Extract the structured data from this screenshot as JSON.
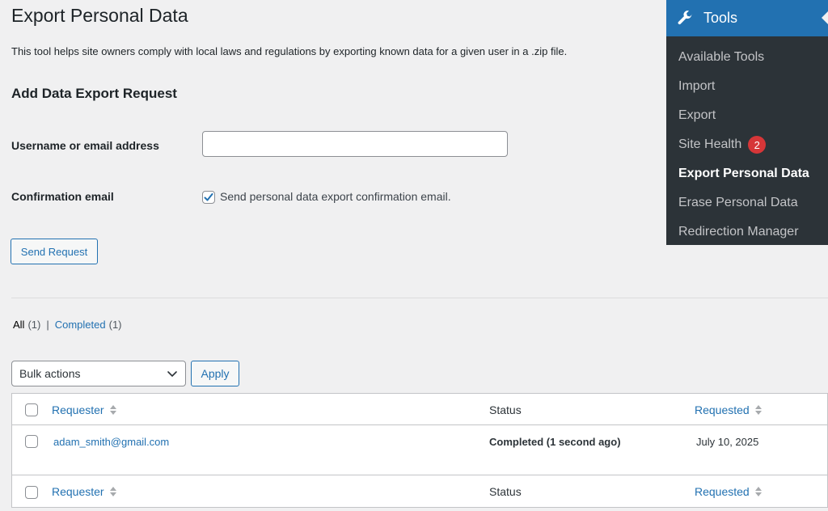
{
  "page": {
    "title": "Export Personal Data",
    "intro": "This tool helps site owners comply with local laws and regulations by exporting known data for a given user in a .zip file."
  },
  "form": {
    "section_title": "Add Data Export Request",
    "username_label": "Username or email address",
    "username_value": "",
    "confirm_label": "Confirmation email",
    "confirm_checkbox_text": "Send personal data export confirmation email.",
    "confirm_checked": true,
    "send_button": "Send Request"
  },
  "filters": {
    "all_label": "All",
    "all_count": "(1)",
    "separator": "|",
    "completed_label": "Completed",
    "completed_count": "(1)"
  },
  "bulk": {
    "selected": "Bulk actions",
    "apply_label": "Apply"
  },
  "table": {
    "columns": {
      "requester": "Requester",
      "status": "Status",
      "requested": "Requested"
    },
    "rows": [
      {
        "requester": "adam_smith@gmail.com",
        "status": "Completed (1 second ago)",
        "requested": "July 10, 2025"
      }
    ]
  },
  "menu": {
    "title": "Tools",
    "icon": "wrench-icon",
    "items": [
      {
        "label": "Available Tools"
      },
      {
        "label": "Import"
      },
      {
        "label": "Export"
      },
      {
        "label": "Site Health",
        "badge": "2"
      },
      {
        "label": "Export Personal Data",
        "active": true
      },
      {
        "label": "Erase Personal Data"
      },
      {
        "label": "Redirection Manager"
      }
    ]
  },
  "colors": {
    "accent": "#2271b1",
    "menu_bg": "#2c3338",
    "badge": "#d63638",
    "page_bg": "#f0f0f1"
  }
}
